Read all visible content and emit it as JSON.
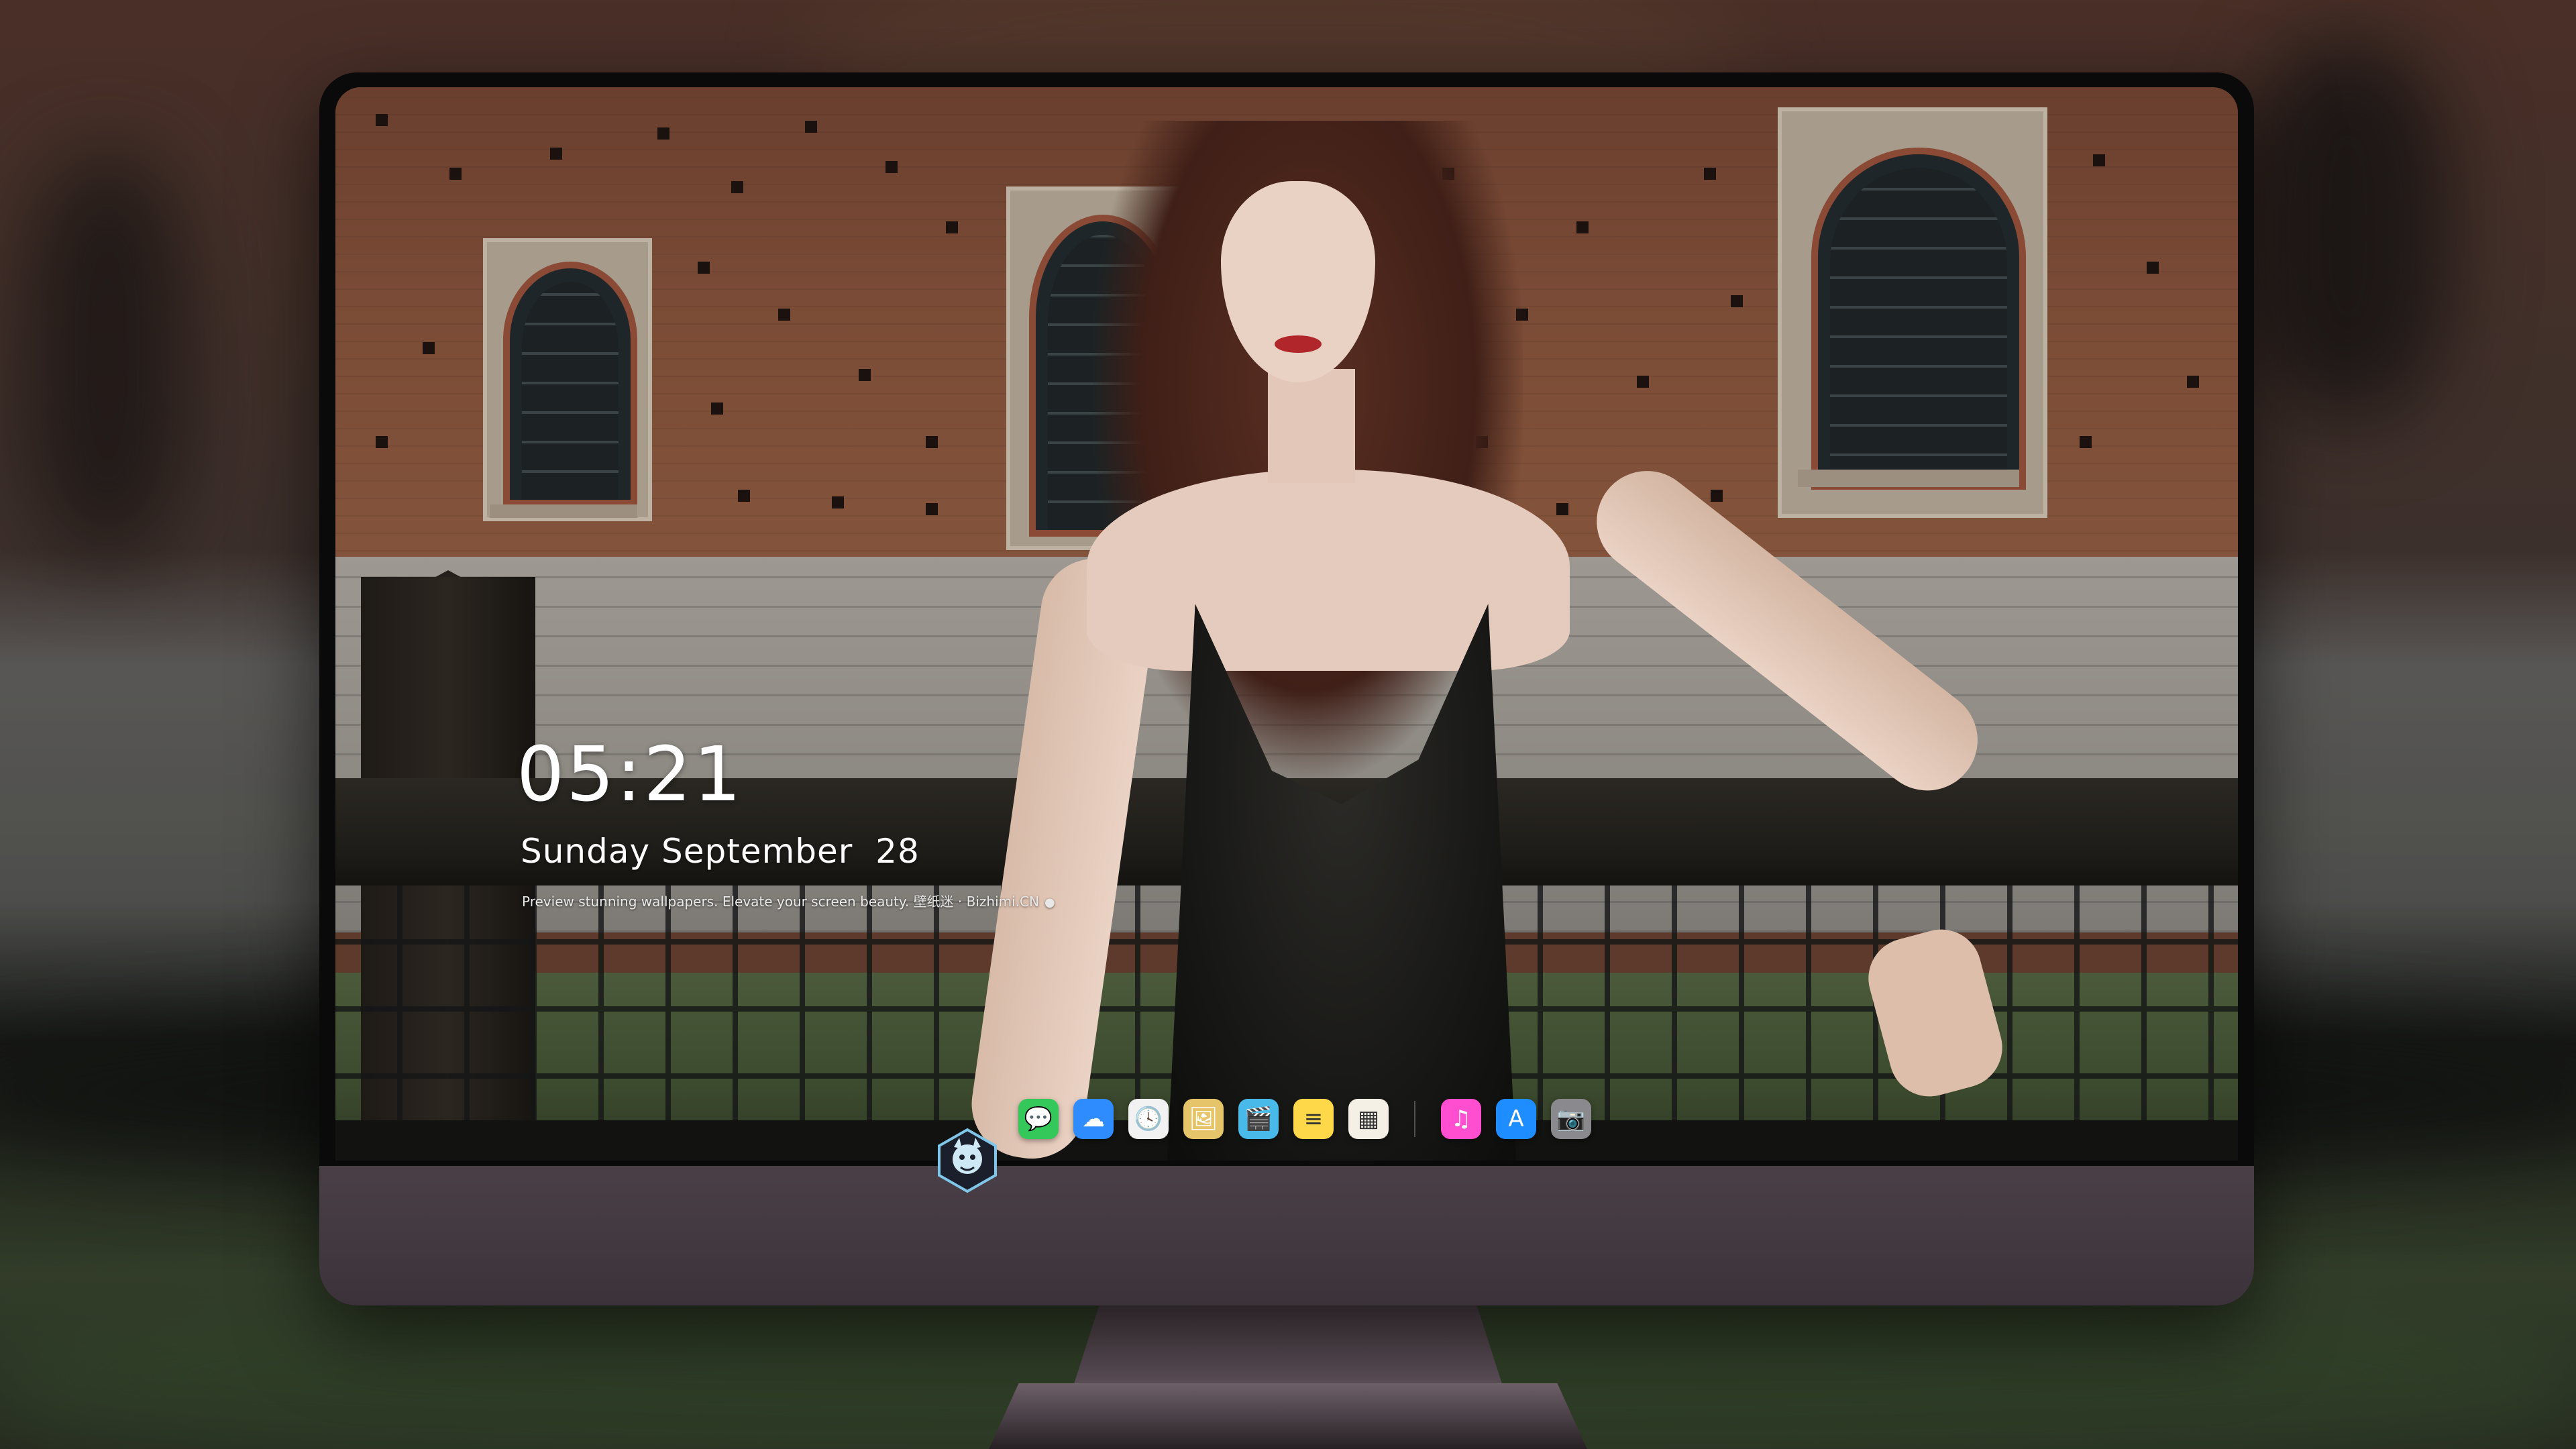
{
  "lock_screen": {
    "time": "05:21",
    "date": "Sunday September  28",
    "tagline": "Preview stunning wallpapers. Elevate your screen beauty. 壁纸迷 · Bizhimi.CN",
    "tagline_icon": "microphone-icon"
  },
  "dock": {
    "apps": [
      {
        "name": "Messages",
        "icon": "messages-icon",
        "glyph": "💬",
        "color": "#34c759"
      },
      {
        "name": "Weather",
        "icon": "weather-icon",
        "glyph": "☁",
        "color": "#2f8cff"
      },
      {
        "name": "Clock",
        "icon": "clock-icon",
        "glyph": "🕓",
        "color": "#f2f2f2"
      },
      {
        "name": "Preview",
        "icon": "preview-icon",
        "glyph": "🖼",
        "color": "#e6c469"
      },
      {
        "name": "Clips",
        "icon": "clips-icon",
        "glyph": "🎬",
        "color": "#48b9e8"
      },
      {
        "name": "Notes",
        "icon": "notes-icon",
        "glyph": "≡",
        "color": "#ffd84a"
      },
      {
        "name": "Photo Booth",
        "icon": "photo-booth-icon",
        "glyph": "▦",
        "color": "#f5f0e6"
      },
      {
        "name": "Music",
        "icon": "music-icon",
        "glyph": "♫",
        "color": "#ff4ed0"
      },
      {
        "name": "App Store",
        "icon": "app-store-icon",
        "glyph": "A",
        "color": "#1d8dff"
      },
      {
        "name": "Camera",
        "icon": "camera-icon",
        "glyph": "📷",
        "color": "#8a8a8e"
      }
    ]
  },
  "monitor": {
    "logo_icon": "bizhimi-mascot-logo"
  }
}
